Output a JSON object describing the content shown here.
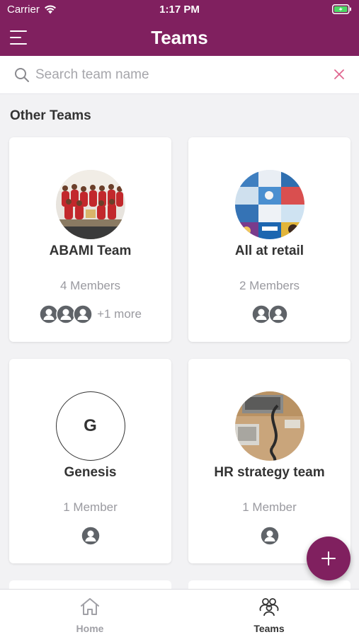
{
  "status_bar": {
    "carrier": "Carrier",
    "time": "1:17 PM"
  },
  "app_bar": {
    "title": "Teams",
    "menu_icon": "hamburger-menu-icon"
  },
  "search": {
    "placeholder": "Search team name",
    "value": ""
  },
  "section": {
    "title": "Other Teams"
  },
  "teams": [
    {
      "name": "ABAMI Team",
      "members_label": "4 Members",
      "avatar": "group-photo",
      "member_icons": 3,
      "more_label": "+1 more"
    },
    {
      "name": "All at retail",
      "members_label": "2 Members",
      "avatar": "collage-photo",
      "member_icons": 2,
      "more_label": ""
    },
    {
      "name": "Genesis",
      "members_label": "1 Member",
      "avatar": "letter",
      "letter": "G",
      "member_icons": 1,
      "more_label": ""
    },
    {
      "name": "HR strategy team",
      "members_label": "1 Member",
      "avatar": "desk-photo",
      "member_icons": 1,
      "more_label": ""
    }
  ],
  "fab": {
    "icon": "plus-icon"
  },
  "bottom_nav": {
    "items": [
      {
        "label": "Home",
        "icon": "home-icon",
        "active": false
      },
      {
        "label": "Teams",
        "icon": "teams-icon",
        "active": true
      }
    ]
  },
  "colors": {
    "primary": "#80205f",
    "clear_icon": "#e0668f",
    "muted_text": "#9a9aa0",
    "member_icon": "#5f6368"
  }
}
